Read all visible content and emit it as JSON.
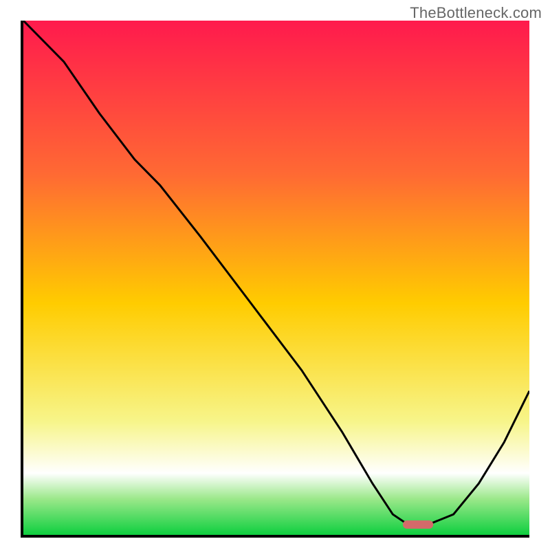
{
  "watermark": "TheBottleneck.com",
  "colors": {
    "axis": "#000000",
    "curve": "#000000",
    "marker_fill": "#d46a6a",
    "green_band_top": "#9be88a",
    "green_band_bottom": "#0ecf3f",
    "grad_top": "#ff1a4d",
    "grad_mid_upper": "#ff6a33",
    "grad_mid": "#ffcc00",
    "grad_lower": "#f7f58a",
    "grad_bottom": "#ffffff"
  },
  "chart_data": {
    "type": "line",
    "title": "",
    "xlabel": "",
    "ylabel": "",
    "xlim": [
      0,
      100
    ],
    "ylim": [
      0,
      100
    ],
    "x": [
      0,
      8,
      15,
      22,
      27,
      35,
      45,
      55,
      63,
      69,
      73,
      76,
      80,
      85,
      90,
      95,
      100
    ],
    "values": [
      100,
      92,
      82,
      73,
      68,
      58,
      45,
      32,
      20,
      10,
      4,
      2,
      2,
      4,
      10,
      18,
      28
    ],
    "optimum_marker": {
      "x": 78,
      "y": 2,
      "width": 6
    },
    "gradient_bands": [
      {
        "stop": 0.0,
        "color_key": "grad_top"
      },
      {
        "stop": 0.3,
        "color_key": "grad_mid_upper"
      },
      {
        "stop": 0.55,
        "color_key": "grad_mid"
      },
      {
        "stop": 0.78,
        "color_key": "grad_lower"
      },
      {
        "stop": 0.88,
        "color_key": "grad_bottom"
      },
      {
        "stop": 0.93,
        "color_key": "green_band_top"
      },
      {
        "stop": 1.0,
        "color_key": "green_band_bottom"
      }
    ]
  }
}
